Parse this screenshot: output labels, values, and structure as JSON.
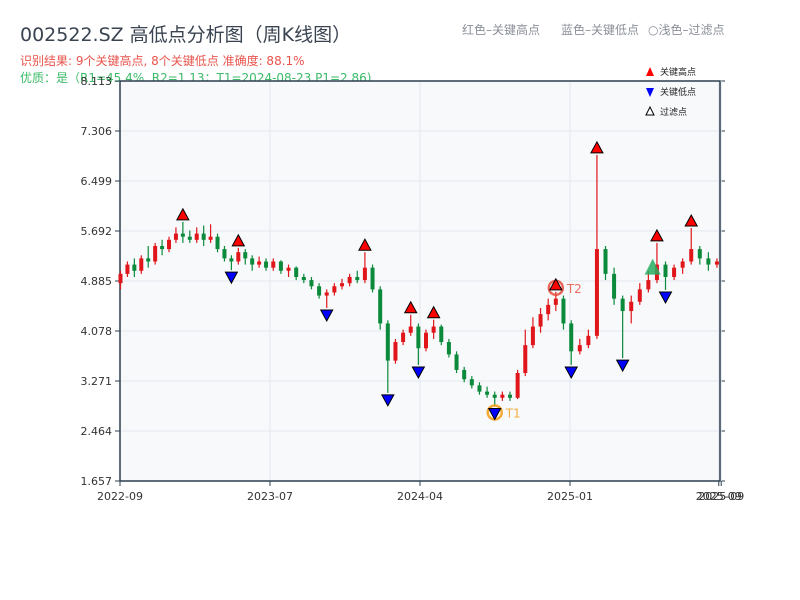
{
  "title": "002522.SZ 高低点分析图（周K线图）",
  "subtitle_result": "识别结果: 9个关键高点, 8个关键低点  准确度: 88.1%",
  "subtitle_quality": "优质：是（R1=45.4%, R2=1.13；T1=2024-08-23 P1=2.86)",
  "top_legend": [
    "红色–关键高点",
    "蓝色–关键低点",
    "○浅色–过滤点"
  ],
  "colors": {
    "up": "#e0161b",
    "down": "#0a8a3a",
    "high_marker": "#ff0000",
    "low_marker": "#0000ff",
    "t1": "#f39c12",
    "t2": "#e74c3c",
    "plot_bg": "#f7f9fb",
    "axis": "#2c3e50"
  },
  "chart_data": {
    "type": "candlestick",
    "ylim": [
      1.657,
      8.113
    ],
    "yticks": [
      "1.657",
      "2.464",
      "3.271",
      "4.078",
      "4.885",
      "5.692",
      "6.499",
      "7.306",
      "8.113"
    ],
    "xticks": [
      {
        "label": "2022-09",
        "date": "2022-09-01"
      },
      {
        "label": "2023-07",
        "date": "2023-07-01"
      },
      {
        "label": "2024-04",
        "date": "2024-04-01"
      },
      {
        "label": "2025-01",
        "date": "2025-01-01"
      },
      {
        "label": "2025-09",
        "date": "2025-09-01"
      },
      {
        "label": "2025-09",
        "date": "2025-09-05"
      }
    ],
    "legend": {
      "placement": "top-right",
      "entries": [
        {
          "label": "关键高点",
          "marker": "red-up-triangle"
        },
        {
          "label": "关键低点",
          "marker": "blue-down-triangle"
        },
        {
          "label": "过滤点",
          "marker": "hollow-up-triangle"
        }
      ]
    },
    "candle_fields": [
      "date",
      "open",
      "close",
      "high",
      "low"
    ],
    "candles": [
      [
        "2022-09-02",
        4.85,
        5.0,
        5.05,
        4.75
      ],
      [
        "2022-09-16",
        5.0,
        5.15,
        5.2,
        4.95
      ],
      [
        "2022-09-30",
        5.15,
        5.05,
        5.25,
        4.95
      ],
      [
        "2022-10-14",
        5.05,
        5.25,
        5.3,
        5.0
      ],
      [
        "2022-10-28",
        5.25,
        5.2,
        5.45,
        5.1
      ],
      [
        "2022-11-11",
        5.2,
        5.45,
        5.5,
        5.15
      ],
      [
        "2022-11-25",
        5.45,
        5.4,
        5.55,
        5.3
      ],
      [
        "2022-12-09",
        5.4,
        5.55,
        5.6,
        5.35
      ],
      [
        "2022-12-23",
        5.55,
        5.65,
        5.75,
        5.5
      ],
      [
        "2023-01-06",
        5.65,
        5.6,
        5.84,
        5.5
      ],
      [
        "2023-01-20",
        5.6,
        5.55,
        5.7,
        5.5
      ],
      [
        "2023-02-03",
        5.55,
        5.65,
        5.75,
        5.5
      ],
      [
        "2023-02-17",
        5.65,
        5.55,
        5.78,
        5.45
      ],
      [
        "2023-03-03",
        5.55,
        5.6,
        5.8,
        5.5
      ],
      [
        "2023-03-17",
        5.6,
        5.4,
        5.65,
        5.35
      ],
      [
        "2023-03-31",
        5.4,
        5.25,
        5.45,
        5.2
      ],
      [
        "2023-04-14",
        5.25,
        5.2,
        5.3,
        5.06
      ],
      [
        "2023-04-28",
        5.2,
        5.35,
        5.42,
        5.15
      ],
      [
        "2023-05-12",
        5.35,
        5.25,
        5.4,
        5.15
      ],
      [
        "2023-05-26",
        5.25,
        5.15,
        5.3,
        5.05
      ],
      [
        "2023-06-09",
        5.15,
        5.2,
        5.28,
        5.1
      ],
      [
        "2023-06-23",
        5.2,
        5.1,
        5.25,
        5.05
      ],
      [
        "2023-07-07",
        5.1,
        5.2,
        5.25,
        5.05
      ],
      [
        "2023-07-21",
        5.2,
        5.05,
        5.22,
        5.0
      ],
      [
        "2023-08-04",
        5.05,
        5.1,
        5.15,
        4.95
      ],
      [
        "2023-08-18",
        5.1,
        4.95,
        5.12,
        4.9
      ],
      [
        "2023-09-01",
        4.95,
        4.9,
        5.0,
        4.85
      ],
      [
        "2023-09-15",
        4.9,
        4.8,
        4.95,
        4.75
      ],
      [
        "2023-09-29",
        4.8,
        4.65,
        4.85,
        4.6
      ],
      [
        "2023-10-13",
        4.65,
        4.7,
        4.75,
        4.45
      ],
      [
        "2023-10-27",
        4.7,
        4.8,
        4.85,
        4.65
      ],
      [
        "2023-11-10",
        4.8,
        4.85,
        4.92,
        4.75
      ],
      [
        "2023-11-24",
        4.85,
        4.95,
        5.0,
        4.8
      ],
      [
        "2023-12-08",
        4.95,
        4.9,
        5.05,
        4.85
      ],
      [
        "2023-12-22",
        4.9,
        5.1,
        5.35,
        4.85
      ],
      [
        "2024-01-05",
        5.1,
        4.75,
        5.15,
        4.7
      ],
      [
        "2024-01-19",
        4.75,
        4.2,
        4.8,
        4.1
      ],
      [
        "2024-02-02",
        4.2,
        3.6,
        4.25,
        3.08
      ],
      [
        "2024-02-16",
        3.6,
        3.9,
        3.95,
        3.55
      ],
      [
        "2024-03-01",
        3.9,
        4.05,
        4.1,
        3.85
      ],
      [
        "2024-03-15",
        4.05,
        4.15,
        4.34,
        4.0
      ],
      [
        "2024-03-29",
        4.15,
        3.8,
        4.2,
        3.53
      ],
      [
        "2024-04-12",
        3.8,
        4.05,
        4.1,
        3.75
      ],
      [
        "2024-04-26",
        4.05,
        4.15,
        4.26,
        3.95
      ],
      [
        "2024-05-10",
        4.15,
        3.9,
        4.18,
        3.85
      ],
      [
        "2024-05-24",
        3.9,
        3.7,
        3.95,
        3.65
      ],
      [
        "2024-06-07",
        3.7,
        3.45,
        3.75,
        3.4
      ],
      [
        "2024-06-21",
        3.45,
        3.3,
        3.5,
        3.25
      ],
      [
        "2024-07-05",
        3.3,
        3.2,
        3.35,
        3.15
      ],
      [
        "2024-07-19",
        3.2,
        3.1,
        3.25,
        3.05
      ],
      [
        "2024-08-02",
        3.1,
        3.05,
        3.18,
        3.0
      ],
      [
        "2024-08-16",
        3.05,
        3.0,
        3.1,
        2.86
      ],
      [
        "2024-08-30",
        3.0,
        3.05,
        3.1,
        2.95
      ],
      [
        "2024-09-13",
        3.05,
        3.0,
        3.1,
        2.95
      ],
      [
        "2024-09-27",
        3.0,
        3.4,
        3.45,
        2.98
      ],
      [
        "2024-10-11",
        3.4,
        3.85,
        4.1,
        3.35
      ],
      [
        "2024-10-25",
        3.85,
        4.15,
        4.3,
        3.8
      ],
      [
        "2024-11-08",
        4.15,
        4.35,
        4.45,
        4.05
      ],
      [
        "2024-11-22",
        4.35,
        4.5,
        4.6,
        4.25
      ],
      [
        "2024-12-06",
        4.5,
        4.6,
        4.71,
        4.4
      ],
      [
        "2024-12-20",
        4.6,
        4.2,
        4.65,
        4.1
      ],
      [
        "2025-01-03",
        4.2,
        3.75,
        4.25,
        3.53
      ],
      [
        "2025-01-17",
        3.75,
        3.85,
        3.95,
        3.7
      ],
      [
        "2025-01-31",
        3.85,
        4.0,
        4.1,
        3.8
      ],
      [
        "2025-02-14",
        4.0,
        5.4,
        6.92,
        3.95
      ],
      [
        "2025-02-28",
        5.4,
        5.0,
        5.45,
        4.9
      ],
      [
        "2025-03-14",
        5.0,
        4.6,
        5.1,
        4.5
      ],
      [
        "2025-03-28",
        4.6,
        4.4,
        4.65,
        3.64
      ],
      [
        "2025-04-11",
        4.4,
        4.55,
        4.65,
        4.2
      ],
      [
        "2025-04-25",
        4.55,
        4.75,
        4.85,
        4.5
      ],
      [
        "2025-05-09",
        4.75,
        4.9,
        5.05,
        4.7
      ],
      [
        "2025-05-23",
        4.9,
        5.15,
        5.5,
        4.85
      ],
      [
        "2025-06-06",
        5.15,
        4.95,
        5.2,
        4.74
      ],
      [
        "2025-06-20",
        4.95,
        5.1,
        5.15,
        4.9
      ],
      [
        "2025-07-04",
        5.1,
        5.2,
        5.25,
        5.0
      ],
      [
        "2025-07-18",
        5.2,
        5.4,
        5.74,
        5.15
      ],
      [
        "2025-08-01",
        5.4,
        5.25,
        5.45,
        5.15
      ],
      [
        "2025-08-15",
        5.25,
        5.15,
        5.35,
        5.05
      ],
      [
        "2025-08-29",
        5.15,
        5.2,
        5.25,
        5.1
      ]
    ],
    "key_highs": [
      [
        "2023-01-06",
        5.84
      ],
      [
        "2023-04-28",
        5.42
      ],
      [
        "2023-12-22",
        5.35
      ],
      [
        "2024-03-15",
        4.34
      ],
      [
        "2024-04-26",
        4.26
      ],
      [
        "2024-12-06",
        4.71
      ],
      [
        "2025-02-14",
        6.92
      ],
      [
        "2025-05-23",
        5.5
      ],
      [
        "2025-07-18",
        5.74
      ]
    ],
    "key_lows": [
      [
        "2023-04-14",
        5.06
      ],
      [
        "2023-10-13",
        4.45
      ],
      [
        "2024-02-02",
        3.08
      ],
      [
        "2024-03-29",
        3.53
      ],
      [
        "2024-08-16",
        2.86
      ],
      [
        "2025-01-03",
        3.53
      ],
      [
        "2025-03-28",
        3.64
      ],
      [
        "2025-06-06",
        4.74
      ]
    ],
    "filtered_points": [
      [
        "2025-05-16",
        5.1
      ]
    ],
    "annotations": [
      {
        "label": "T1",
        "date": "2024-08-16",
        "value": 2.86,
        "color": "#f39c12"
      },
      {
        "label": "T2",
        "date": "2024-12-06",
        "value": 4.71,
        "color": "#e74c3c"
      }
    ]
  }
}
